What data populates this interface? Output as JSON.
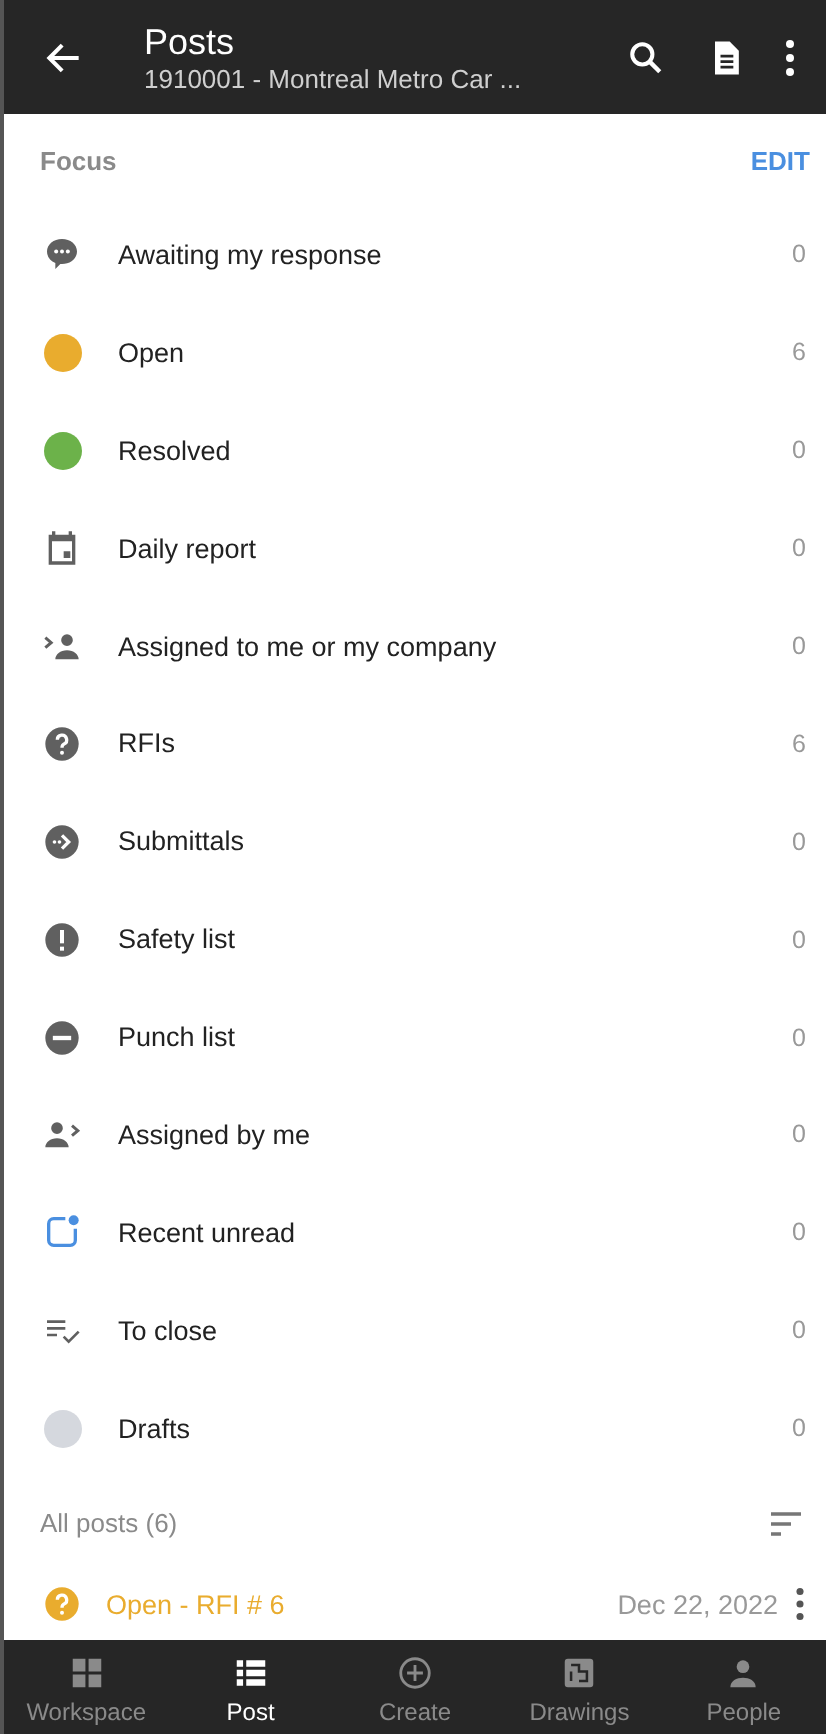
{
  "app_bar": {
    "title": "Posts",
    "subtitle": "1910001 - Montreal Metro Car ..."
  },
  "focus": {
    "heading": "Focus",
    "action": "EDIT",
    "items": [
      {
        "kind": "chat",
        "label": "Awaiting my response",
        "count": "0"
      },
      {
        "kind": "dot",
        "color": "#e9ac2e",
        "label": "Open",
        "count": "6"
      },
      {
        "kind": "dot",
        "color": "#6cb24a",
        "label": "Resolved",
        "count": "0"
      },
      {
        "kind": "calendar",
        "label": "Daily report",
        "count": "0"
      },
      {
        "kind": "assign-in",
        "label": "Assigned to me or my company",
        "count": "0"
      },
      {
        "kind": "question",
        "label": "RFIs",
        "count": "6"
      },
      {
        "kind": "submittal",
        "label": "Submittals",
        "count": "0"
      },
      {
        "kind": "alert",
        "label": "Safety list",
        "count": "0"
      },
      {
        "kind": "punch",
        "label": "Punch list",
        "count": "0"
      },
      {
        "kind": "assign-out",
        "label": "Assigned by me",
        "count": "0"
      },
      {
        "kind": "unread",
        "label": "Recent unread",
        "count": "0"
      },
      {
        "kind": "to-close",
        "label": "To close",
        "count": "0"
      },
      {
        "kind": "dot",
        "color": "#d5d8de",
        "label": "Drafts",
        "count": "0"
      }
    ]
  },
  "all_posts": {
    "heading": "All posts (6)",
    "posts": [
      {
        "title": "Open - RFI # 6",
        "date": "Dec 22, 2022"
      }
    ]
  },
  "bottom_nav": [
    {
      "kind": "grid",
      "label": "Workspace",
      "selected": false
    },
    {
      "kind": "list",
      "label": "Post",
      "selected": true
    },
    {
      "kind": "plus",
      "label": "Create",
      "selected": false
    },
    {
      "kind": "drawing",
      "label": "Drawings",
      "selected": false
    },
    {
      "kind": "person",
      "label": "People",
      "selected": false
    }
  ]
}
